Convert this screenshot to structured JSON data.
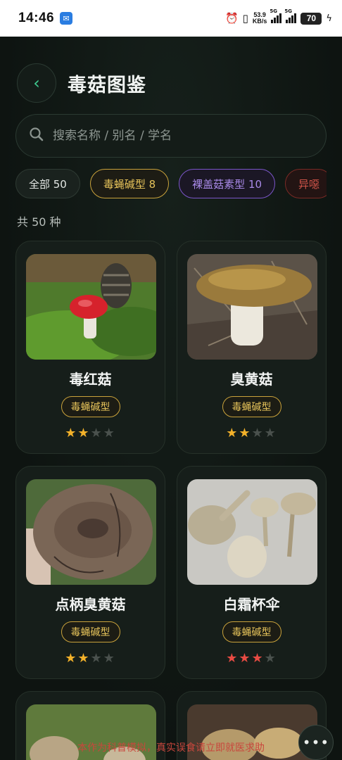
{
  "status_bar": {
    "time": "14:46",
    "net_speed_value": "53.9",
    "net_speed_unit": "KB/s",
    "sim1_label": "5G",
    "sim2_label": "5G",
    "battery": "70"
  },
  "header": {
    "title": "毒菇图鉴",
    "back_icon": "chevron-left-icon"
  },
  "search": {
    "placeholder": "搜索名称 / 别名 / 学名",
    "value": ""
  },
  "filters": [
    {
      "label": "全部 50",
      "style": "neutral"
    },
    {
      "label": "毒蝇碱型 8",
      "style": "gold",
      "color": "#c9a23b"
    },
    {
      "label": "裸盖菇素型 10",
      "style": "purple",
      "color": "#7b55c9"
    },
    {
      "label": "异噁",
      "style": "red",
      "color": "#c9463c"
    }
  ],
  "count_text": "共 50 种",
  "species": [
    {
      "name": "毒红菇",
      "tag": "毒蝇碱型",
      "rating": 2,
      "max_rating": 4,
      "star_color": "#f2b12a"
    },
    {
      "name": "臭黄菇",
      "tag": "毒蝇碱型",
      "rating": 2,
      "max_rating": 4,
      "star_color": "#f2b12a"
    },
    {
      "name": "点柄臭黄菇",
      "tag": "毒蝇碱型",
      "rating": 2,
      "max_rating": 4,
      "star_color": "#f2b12a"
    },
    {
      "name": "白霜杯伞",
      "tag": "毒蝇碱型",
      "rating": 3,
      "max_rating": 4,
      "star_color": "#e84b43"
    }
  ],
  "disclaimer": "本作为科普模拟，真实误食请立即就医求助",
  "more_button_icon": "more-horizontal-icon"
}
